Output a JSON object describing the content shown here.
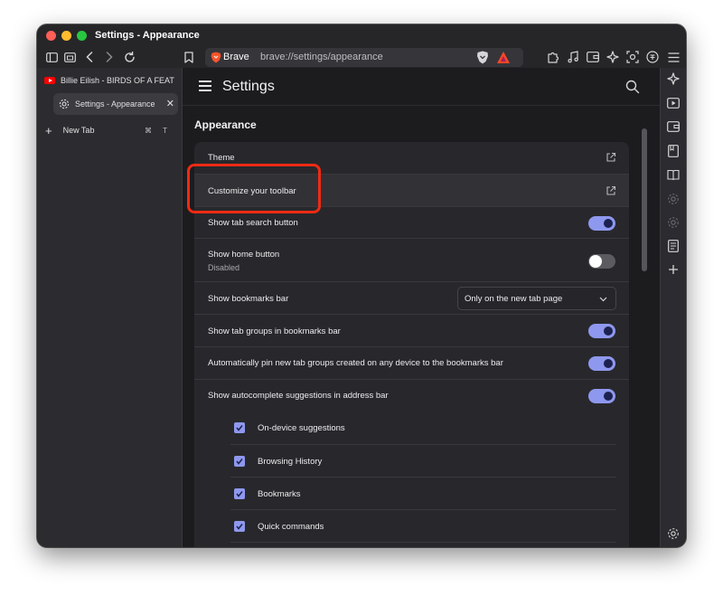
{
  "window": {
    "title": "Settings - Appearance"
  },
  "toolbar": {
    "icons": [
      "sidebar-toggle-icon",
      "tab-overview-icon",
      "back-icon",
      "forward-icon",
      "reload-icon",
      "bookmark-icon"
    ],
    "brand": "Brave",
    "url": "brave://settings/appearance",
    "right_icons": [
      "extensions-icon",
      "music-icon",
      "wallet-icon",
      "leo-icon",
      "screenshot-icon",
      "vpn-icon",
      "menu-icon"
    ]
  },
  "sidebar": {
    "tabs": [
      {
        "title": "Billie Eilish - BIRDS OF A FEAT",
        "icon": "youtube-icon"
      },
      {
        "title": "Settings - Appearance",
        "icon": "gear-icon",
        "active": true
      }
    ],
    "new_tab": {
      "label": "New Tab",
      "shortcut": "⌘ T"
    }
  },
  "page": {
    "header_title": "Settings",
    "section_title": "Appearance",
    "rows": [
      {
        "label": "Theme",
        "control": "external-link"
      },
      {
        "label": "Customize your toolbar",
        "control": "external-link"
      },
      {
        "label": "Show tab search button",
        "control": "toggle",
        "on": true
      },
      {
        "label": "Show home button",
        "sub": "Disabled",
        "control": "toggle",
        "on": false
      },
      {
        "label": "Show bookmarks bar",
        "control": "select",
        "value": "Only on the new tab page"
      },
      {
        "label": "Show tab groups in bookmarks bar",
        "control": "toggle",
        "on": true
      },
      {
        "label": "Automatically pin new tab groups created on any device to the bookmarks bar",
        "control": "toggle",
        "on": true
      },
      {
        "label": "Show autocomplete suggestions in address bar",
        "control": "toggle",
        "on": true
      }
    ],
    "autocomplete_options": [
      {
        "label": "On-device suggestions",
        "checked": true
      },
      {
        "label": "Browsing History",
        "checked": true
      },
      {
        "label": "Bookmarks",
        "checked": true
      },
      {
        "label": "Quick commands",
        "checked": true
      }
    ]
  },
  "colors": {
    "accent": "#8e98ee",
    "highlight": "#ee2b14",
    "background": "#1c1c1f"
  },
  "rightbar_icons": [
    "leo-icon",
    "playlist-icon",
    "wallet-icon",
    "reading-list-icon",
    "bookmarks-icon",
    "disabled-gear-icon",
    "disabled-gear-icon",
    "notes-icon",
    "add-icon",
    "settings-icon"
  ]
}
